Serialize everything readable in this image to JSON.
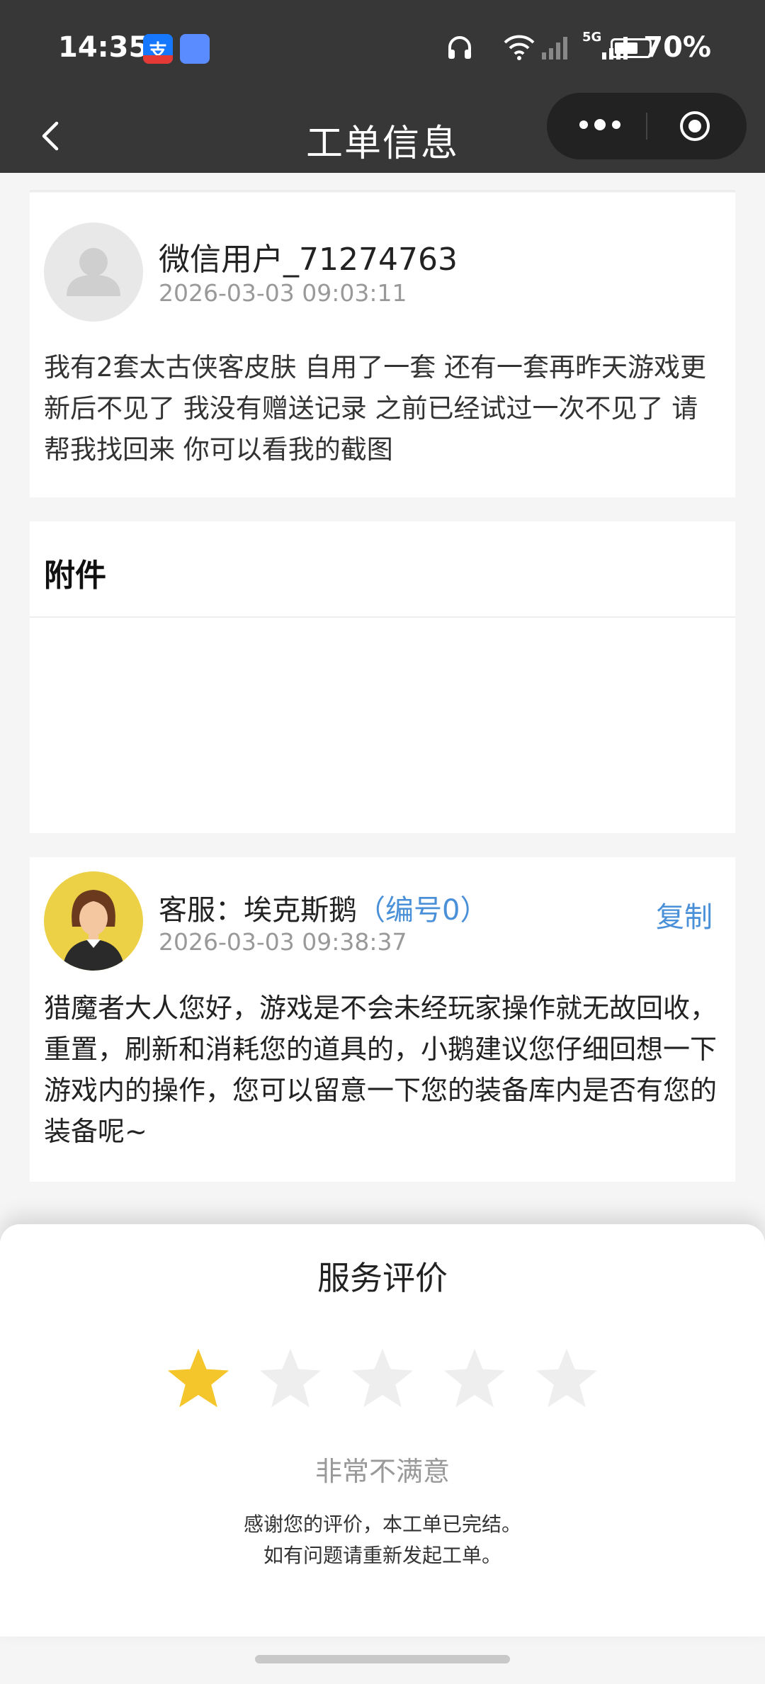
{
  "status": {
    "time": "14:35",
    "battery": "70%",
    "battery_level": 0.7,
    "network": "5G"
  },
  "nav": {
    "title": "工单信息"
  },
  "user_message": {
    "username": "微信用户_71274763",
    "time": "2026-03-03 09:03:11",
    "content": "我有2套太古侠客皮肤 自用了一套 还有一套再昨天游戏更新后不见了  我没有赠送记录 之前已经试过一次不见了  请帮我找回来 你可以看我的截图"
  },
  "attachments": {
    "title": "附件"
  },
  "reply": {
    "agent_label": "客服：埃克斯鹅",
    "agent_id": "（编号0）",
    "copy_label": "复制",
    "time": "2026-03-03 09:38:37",
    "content": "猎魔者大人您好，游戏是不会未经玩家操作就无故回收，重置，刷新和消耗您的道具的，小鹅建议您仔细回想一下游戏内的操作，您可以留意一下您的装备库内是否有您的装备呢~"
  },
  "rating": {
    "title": "服务评价",
    "stars_total": 5,
    "stars_selected": 1,
    "label": "非常不满意",
    "thanks_line1": "感谢您的评价，本工单已完结。",
    "thanks_line2": "如有问题请重新发起工单。",
    "star_color_active": "#f5c62c",
    "star_color_inactive": "#eeeeee"
  },
  "colors": {
    "header_bg": "#373737",
    "link_blue": "#4a90d9"
  }
}
